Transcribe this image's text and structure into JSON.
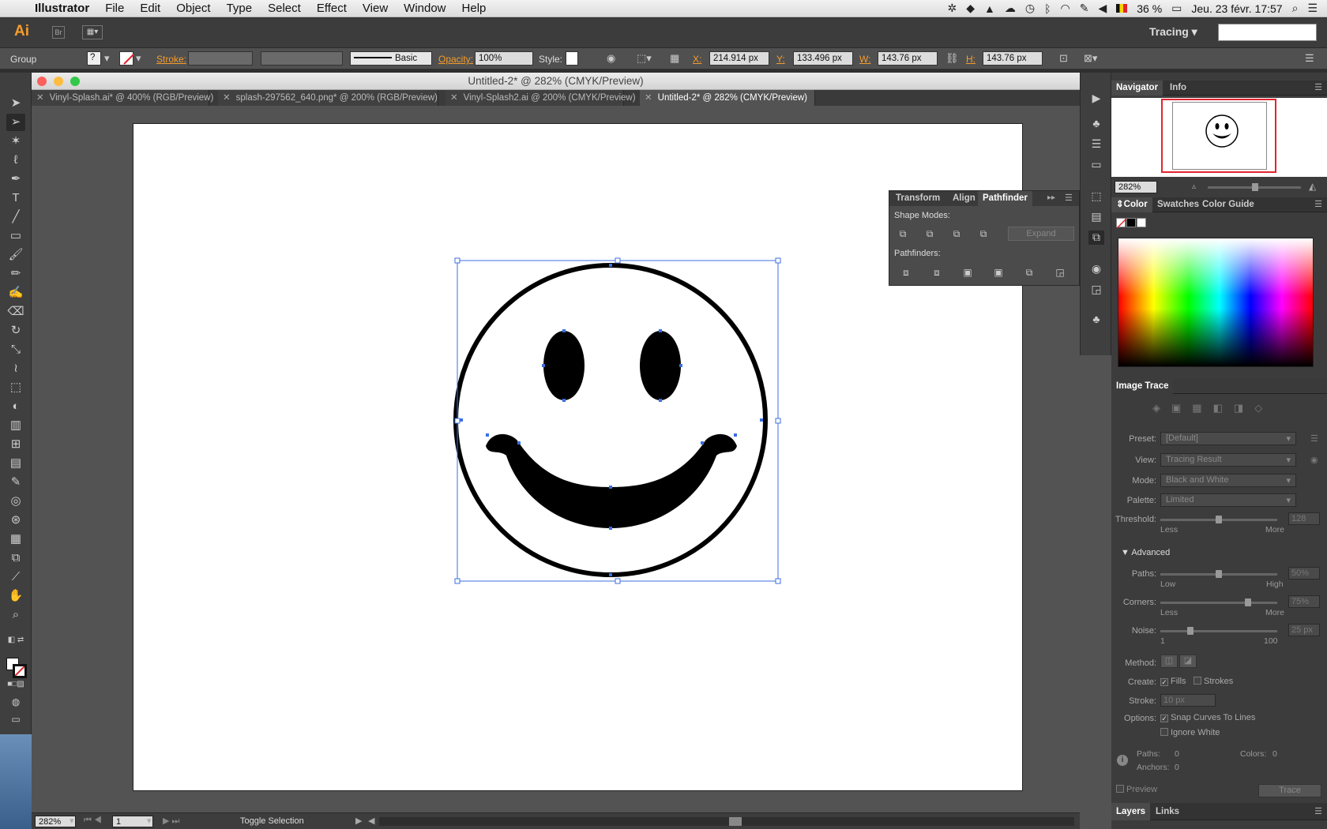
{
  "menubar": {
    "apple": "",
    "app": "Illustrator",
    "items": [
      "File",
      "Edit",
      "Object",
      "Type",
      "Select",
      "Effect",
      "View",
      "Window",
      "Help"
    ],
    "battery": "36 %",
    "datetime": "Jeu. 23 févr.  17:57"
  },
  "appbar": {
    "logo": "Ai",
    "bridge": "Br",
    "workspace": "Tracing"
  },
  "control": {
    "selection_type": "Group",
    "stroke_label": "Stroke:",
    "brush_label": "Basic",
    "opacity_label": "Opacity:",
    "opacity_value": "100%",
    "style_label": "Style:",
    "x_label": "X:",
    "x_value": "214.914 px",
    "y_label": "Y:",
    "y_value": "133.496 px",
    "w_label": "W:",
    "w_value": "143.76 px",
    "h_label": "H:",
    "h_value": "143.76 px"
  },
  "document": {
    "window_title": "Untitled-2* @ 282% (CMYK/Preview)",
    "tabs": [
      {
        "label": "Vinyl-Splash.ai* @ 400% (RGB/Preview)"
      },
      {
        "label": "splash-297562_640.png* @ 200% (RGB/Preview)"
      },
      {
        "label": "Vinyl-Splash2.ai @ 200% (CMYK/Preview)"
      },
      {
        "label": "Untitled-2* @ 282% (CMYK/Preview)"
      }
    ],
    "status": {
      "zoom": "282%",
      "page": "1",
      "info": "Toggle Selection"
    }
  },
  "pathfinder": {
    "tabs": [
      "Transform",
      "Align",
      "Pathfinder"
    ],
    "shape_modes_label": "Shape Modes:",
    "pathfinders_label": "Pathfinders:",
    "expand_label": "Expand"
  },
  "navigator": {
    "tabs": [
      "Navigator",
      "Info"
    ],
    "zoom": "282%"
  },
  "color": {
    "tabs": [
      "Color",
      "Swatches",
      "Color Guide"
    ]
  },
  "image_trace": {
    "title": "Image Trace",
    "preset_label": "Preset:",
    "preset_value": "[Default]",
    "view_label": "View:",
    "view_value": "Tracing Result",
    "mode_label": "Mode:",
    "mode_value": "Black and White",
    "palette_label": "Palette:",
    "palette_value": "Limited",
    "threshold_label": "Threshold:",
    "threshold_value": "128",
    "threshold_less": "Less",
    "threshold_more": "More",
    "advanced_label": "Advanced",
    "paths_label": "Paths:",
    "paths_value": "50%",
    "paths_low": "Low",
    "paths_high": "High",
    "corners_label": "Corners:",
    "corners_value": "75%",
    "corners_less": "Less",
    "corners_more": "More",
    "noise_label": "Noise:",
    "noise_value": "25 px",
    "noise_min": "1",
    "noise_max": "100",
    "method_label": "Method:",
    "create_label": "Create:",
    "fills_label": "Fills",
    "strokes_label": "Strokes",
    "stroke_label": "Stroke:",
    "stroke_value": "10 px",
    "options_label": "Options:",
    "snap_label": "Snap Curves To Lines",
    "ignore_white_label": "Ignore White",
    "paths_count_label": "Paths:",
    "paths_count": "0",
    "colors_count_label": "Colors:",
    "colors_count": "0",
    "anchors_count_label": "Anchors:",
    "anchors_count": "0",
    "preview_label": "Preview",
    "trace_label": "Trace"
  },
  "layers": {
    "tabs": [
      "Layers",
      "Links"
    ]
  }
}
